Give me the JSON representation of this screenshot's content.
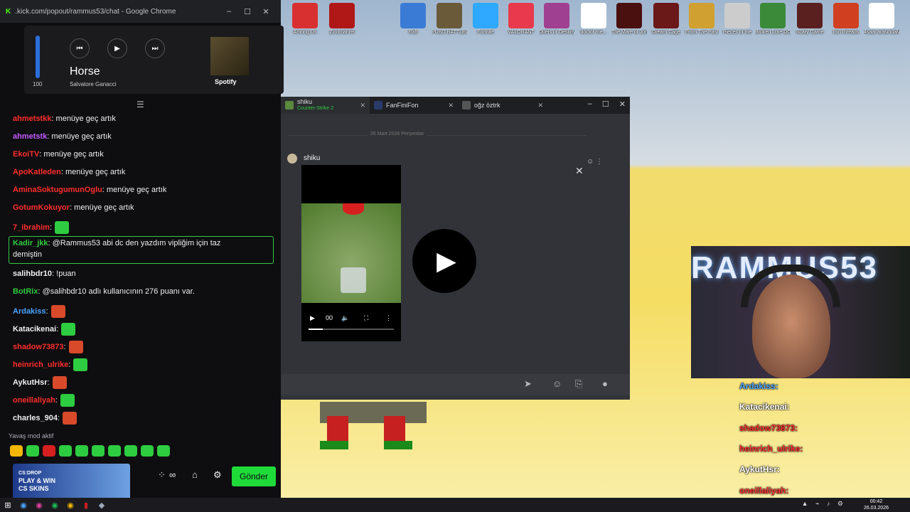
{
  "browser": {
    "title": ".kick.com/popout/rammus53/chat - Google Chrome",
    "minimize": "–",
    "maximize": "☐",
    "close": "✕"
  },
  "spotify": {
    "volume": "100",
    "song": "Horse",
    "artist": "Salvatore Ganacci",
    "brand": "Spotify",
    "prev": "⏮",
    "play": "▶",
    "next": "⏭"
  },
  "chat": {
    "messages": [
      {
        "user": "ahmetstkk",
        "color": "#ff2d2d",
        "text": ": menüye geç artık"
      },
      {
        "user": "ahmetstk",
        "color": "#c35bff",
        "text": ": menüye geç artık"
      },
      {
        "user": "EkoiTV",
        "color": "#ff2d2d",
        "text": ": menüye geç artık"
      },
      {
        "user": "ApoKatleden",
        "color": "#ff2d2d",
        "text": ": menüye geç artık"
      },
      {
        "user": "AminaSoktugumunOglu",
        "color": "#ff2d2d",
        "text": ": menüye geç artık"
      },
      {
        "user": "GotumKokuyor",
        "color": "#ff2d2d",
        "text": ": menüye geç artık"
      },
      {
        "user": "7_ibrahim",
        "color": "#ff2d2d",
        "text": ":"
      },
      {
        "user": "Kadir_jkk",
        "color": "#2ecc40",
        "text": ": @Rammus53 abi dc den yazdım vipliğim için taz"
      },
      {
        "user": "",
        "color": "#efeff1",
        "text": "demiştin"
      },
      {
        "user": "salihbdr10",
        "color": "#efeff1",
        "text": ": !puan"
      },
      {
        "user": "BotRix",
        "color": "#2ecc40",
        "text": ": @salihbdr10 adlı kullanıcının 276 puanı var."
      },
      {
        "user": "Ardakiss",
        "color": "#4aa3ff",
        "text": ":"
      },
      {
        "user": "Katacikenai",
        "color": "#efeff1",
        "text": ":"
      },
      {
        "user": "shadow73873",
        "color": "#ff2d2d",
        "text": ":"
      },
      {
        "user": "heinrich_ulrike",
        "color": "#ff2d2d",
        "text": ":"
      },
      {
        "user": "AykutHsr",
        "color": "#efeff1",
        "text": ":"
      },
      {
        "user": "oneillaliyah",
        "color": "#ff2d2d",
        "text": ":"
      },
      {
        "user": "charles_904",
        "color": "#efeff1",
        "text": ":"
      }
    ],
    "slow_mode": "Yavaş mod aktif",
    "send": "Gönder",
    "ad_line1": "CS:DROP",
    "ad_line2": "PLAY & WIN",
    "ad_line3": "CS SKINS"
  },
  "discord": {
    "tabs": [
      {
        "name": "shiku",
        "sub": "Counter-Strike 2",
        "icon_color": "#5a8a3c"
      },
      {
        "name": "FanFiniFon",
        "sub": "",
        "icon_color": "#2a3b6a"
      },
      {
        "name": "oğz öztrk",
        "sub": "",
        "icon_color": "#555"
      }
    ],
    "date": "26 Mart 2026 Perşembe",
    "author": "shiku",
    "video_time": "00",
    "close": "✕"
  },
  "webcam": {
    "overlay_text": "RAMMUS53"
  },
  "overlay_chat": [
    {
      "user": "Ardakiss:",
      "color": "#4aa3ff"
    },
    {
      "user": "Katacikenai:",
      "color": "#ffffff"
    },
    {
      "user": "shadow73873:",
      "color": "#ff2d2d"
    },
    {
      "user": "heinrich_ulrike:",
      "color": "#ff2d2d"
    },
    {
      "user": "AykutHsr:",
      "color": "#ffffff"
    },
    {
      "user": "oneillaliyah:",
      "color": "#ff2d2d"
    },
    {
      "user": "charles_904:",
      "color": "#ffffff"
    }
  ],
  "desktop_icons": [
    {
      "label": "Among Us",
      "color": "#d83030"
    },
    {
      "label": "Zindmahrel",
      "color": "#b01818"
    },
    {
      "label": "Raft",
      "color": "#3a7bd5"
    },
    {
      "label": "PUBG BATTLEGR...",
      "color": "#6b5a3a"
    },
    {
      "label": "Fortnite",
      "color": "#2fa8ff"
    },
    {
      "label": "VALORANT",
      "color": "#e83a4c"
    },
    {
      "label": "Duels or Destiny Ki...",
      "color": "#a04090"
    },
    {
      "label": "doctor me...",
      "color": "#ffffff"
    },
    {
      "label": "The Mare of Jonah",
      "color": "#4a1010"
    },
    {
      "label": "Dream Cage",
      "color": "#6a1818"
    },
    {
      "label": "From The Past",
      "color": "#d0a030"
    },
    {
      "label": "Pieces of me",
      "color": "#cccccc"
    },
    {
      "label": "Broken Lore DONT W...",
      "color": "#3a8a3a"
    },
    {
      "label": "Scary Game",
      "color": "#5a2020"
    },
    {
      "label": "thin threads",
      "color": "#d04020"
    },
    {
      "label": "4saat arasindaMP3",
      "color": "#ffffff"
    }
  ],
  "taskbar": {
    "time": "00:42",
    "date": "26.03.2026"
  }
}
